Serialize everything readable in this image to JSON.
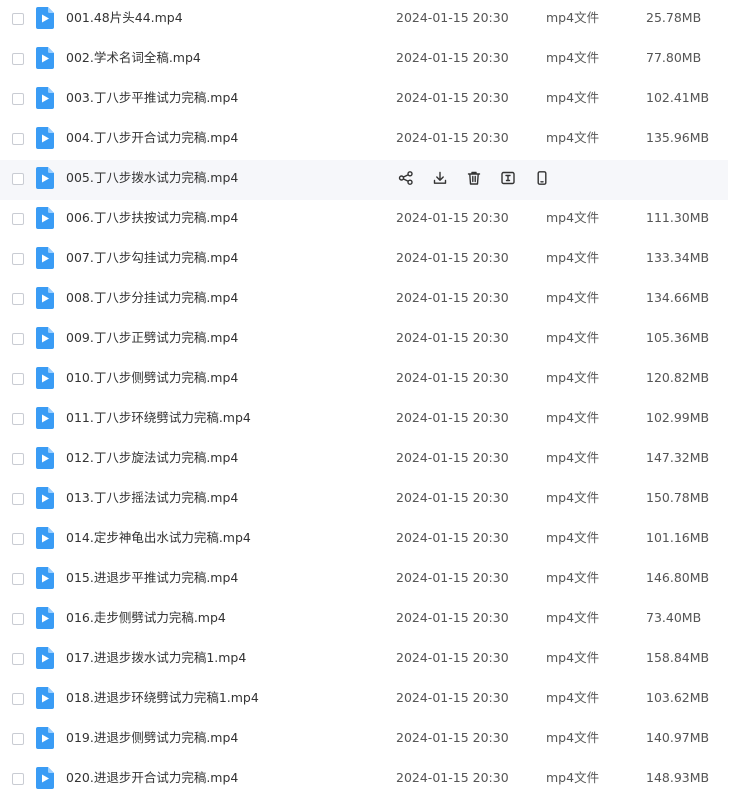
{
  "files": [
    {
      "name": "001.48片头44.mp4",
      "date": "2024-01-15 20:30",
      "type": "mp4文件",
      "size": "25.78MB"
    },
    {
      "name": "002.学术名词全稿.mp4",
      "date": "2024-01-15 20:30",
      "type": "mp4文件",
      "size": "77.80MB"
    },
    {
      "name": "003.丁八步平推试力完稿.mp4",
      "date": "2024-01-15 20:30",
      "type": "mp4文件",
      "size": "102.41MB"
    },
    {
      "name": "004.丁八步开合试力完稿.mp4",
      "date": "2024-01-15 20:30",
      "type": "mp4文件",
      "size": "135.96MB"
    },
    {
      "name": "005.丁八步拨水试力完稿.mp4",
      "date": "",
      "type": "",
      "size": "",
      "hovered": true
    },
    {
      "name": "006.丁八步扶按试力完稿.mp4",
      "date": "2024-01-15 20:30",
      "type": "mp4文件",
      "size": "111.30MB"
    },
    {
      "name": "007.丁八步勾挂试力完稿.mp4",
      "date": "2024-01-15 20:30",
      "type": "mp4文件",
      "size": "133.34MB"
    },
    {
      "name": "008.丁八步分挂试力完稿.mp4",
      "date": "2024-01-15 20:30",
      "type": "mp4文件",
      "size": "134.66MB"
    },
    {
      "name": "009.丁八步正劈试力完稿.mp4",
      "date": "2024-01-15 20:30",
      "type": "mp4文件",
      "size": "105.36MB"
    },
    {
      "name": "010.丁八步侧劈试力完稿.mp4",
      "date": "2024-01-15 20:30",
      "type": "mp4文件",
      "size": "120.82MB"
    },
    {
      "name": "011.丁八步环绕劈试力完稿.mp4",
      "date": "2024-01-15 20:30",
      "type": "mp4文件",
      "size": "102.99MB"
    },
    {
      "name": "012.丁八步旋法试力完稿.mp4",
      "date": "2024-01-15 20:30",
      "type": "mp4文件",
      "size": "147.32MB"
    },
    {
      "name": "013.丁八步摇法试力完稿.mp4",
      "date": "2024-01-15 20:30",
      "type": "mp4文件",
      "size": "150.78MB"
    },
    {
      "name": "014.定步神龟出水试力完稿.mp4",
      "date": "2024-01-15 20:30",
      "type": "mp4文件",
      "size": "101.16MB"
    },
    {
      "name": "015.进退步平推试力完稿.mp4",
      "date": "2024-01-15 20:30",
      "type": "mp4文件",
      "size": "146.80MB"
    },
    {
      "name": "016.走步侧劈试力完稿.mp4",
      "date": "2024-01-15 20:30",
      "type": "mp4文件",
      "size": "73.40MB"
    },
    {
      "name": "017.进退步拨水试力完稿1.mp4",
      "date": "2024-01-15 20:30",
      "type": "mp4文件",
      "size": "158.84MB"
    },
    {
      "name": "018.进退步环绕劈试力完稿1.mp4",
      "date": "2024-01-15 20:30",
      "type": "mp4文件",
      "size": "103.62MB"
    },
    {
      "name": "019.进退步侧劈试力完稿.mp4",
      "date": "2024-01-15 20:30",
      "type": "mp4文件",
      "size": "140.97MB"
    },
    {
      "name": "020.进退步开合试力完稿.mp4",
      "date": "2024-01-15 20:30",
      "type": "mp4文件",
      "size": "148.93MB"
    }
  ],
  "row_actions": [
    {
      "icon": "share-icon"
    },
    {
      "icon": "download-icon"
    },
    {
      "icon": "delete-icon"
    },
    {
      "icon": "rename-icon"
    },
    {
      "icon": "phone-icon"
    }
  ],
  "colors": {
    "file_icon": "#3a9cf5",
    "hover_bg": "#f6f7fa"
  }
}
